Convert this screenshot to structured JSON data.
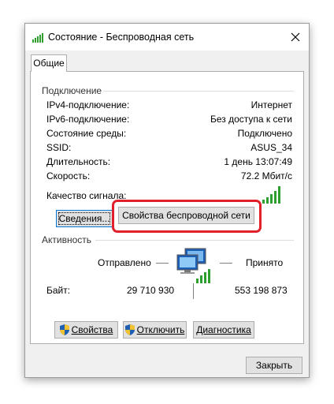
{
  "window": {
    "title": "Состояние - Беспроводная сеть",
    "close_symbol": "✕",
    "title_icon": "wifi-signal-icon"
  },
  "tabs": [
    {
      "label": "Общие",
      "selected": true
    }
  ],
  "connection": {
    "heading": "Подключение",
    "rows": [
      {
        "key": "IPv4-подключение:",
        "value": "Интернет"
      },
      {
        "key": "IPv6-подключение:",
        "value": "Без доступа к сети"
      },
      {
        "key": "Состояние среды:",
        "value": "Подключено"
      },
      {
        "key": "SSID:",
        "value": "ASUS_34"
      },
      {
        "key": "Длительность:",
        "value": "1 день 13:07:49"
      },
      {
        "key": "Скорость:",
        "value": "72.2 Мбит/с"
      }
    ],
    "signal_label": "Качество сигнала:",
    "signal_bars_lit": 5,
    "signal_bars_total": 5,
    "details_button": "Сведения...",
    "wireless_props_button": "Свойства беспроводной сети"
  },
  "activity": {
    "heading": "Активность",
    "sent_label": "Отправлено",
    "received_label": "Принято",
    "bytes_label": "Байт:",
    "bytes_sent": "29 710 930",
    "bytes_received": "553 198 873",
    "icon": "network-computers-icon"
  },
  "bottom_buttons": {
    "properties": "Свойства",
    "disable": "Отключить",
    "diagnose": "Диагностика"
  },
  "close_button": "Закрыть",
  "colors": {
    "signal_green": "#2e9e2e",
    "highlight_red": "#e0202a",
    "focus_blue": "#0078d7"
  }
}
